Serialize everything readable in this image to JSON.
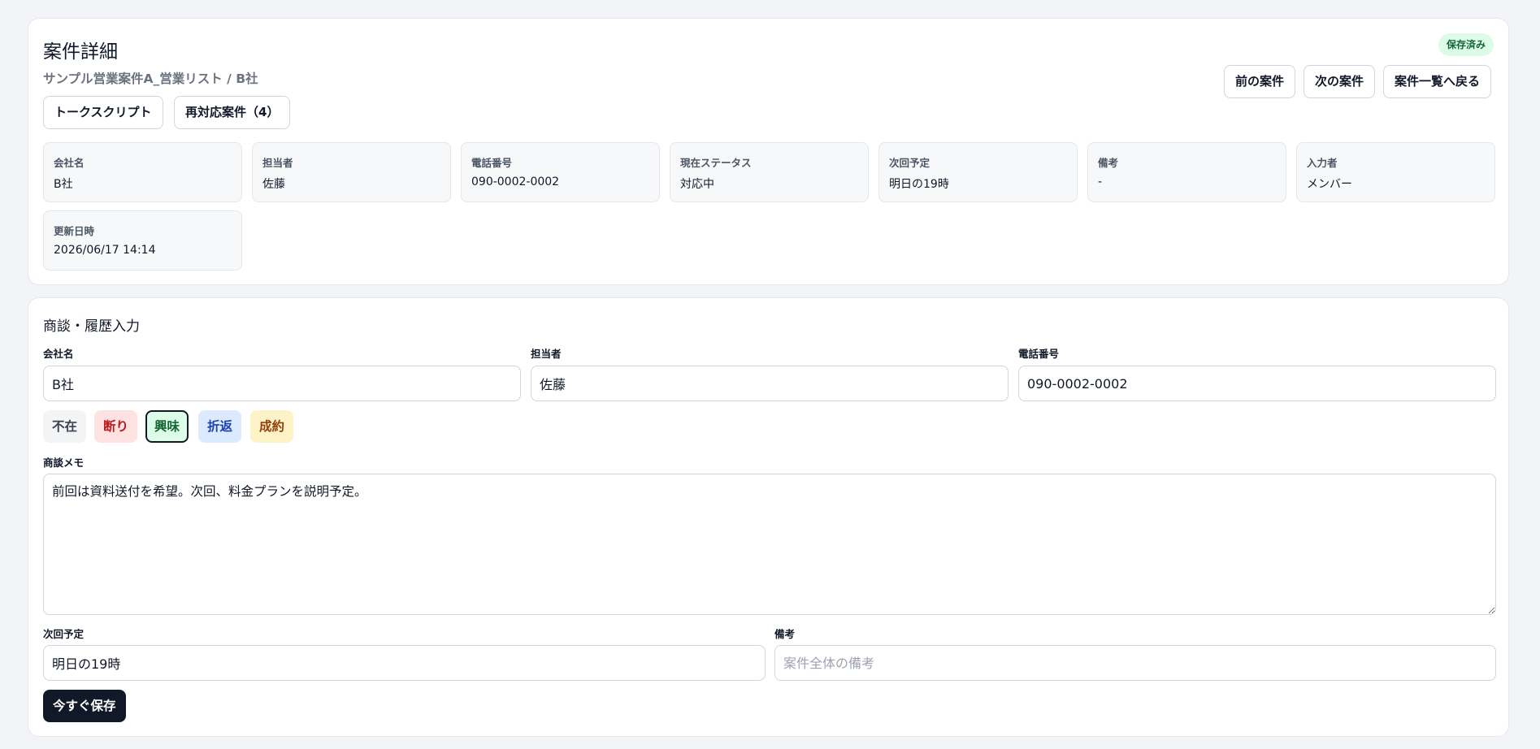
{
  "detail": {
    "title": "案件詳細",
    "subtitle": "サンプル営業案件A_営業リスト / B社",
    "saved_badge": "保存済み",
    "tabs": {
      "talk_script": "トークスクリプト",
      "recontact": "再対応案件（4）"
    },
    "nav": {
      "prev": "前の案件",
      "next": "次の案件",
      "back": "案件一覧へ戻る"
    },
    "info": [
      {
        "label": "会社名",
        "value": "B社"
      },
      {
        "label": "担当者",
        "value": "佐藤"
      },
      {
        "label": "電話番号",
        "value": "090-0002-0002"
      },
      {
        "label": "現在ステータス",
        "value": "対応中"
      },
      {
        "label": "次回予定",
        "value": "明日の19時"
      },
      {
        "label": "備考",
        "value": "-"
      },
      {
        "label": "入力者",
        "value": "メンバー"
      },
      {
        "label": "更新日時",
        "value": "2026/06/17 14:14"
      }
    ]
  },
  "entry": {
    "section_title": "商談・履歴入力",
    "company": {
      "label": "会社名",
      "value": "B社"
    },
    "person": {
      "label": "担当者",
      "value": "佐藤"
    },
    "phone": {
      "label": "電話番号",
      "value": "090-0002-0002"
    },
    "statuses": [
      {
        "label": "不在",
        "bg": "#f3f4f6",
        "color": "#374151",
        "active": false
      },
      {
        "label": "断り",
        "bg": "#fee2e2",
        "color": "#b91c1c",
        "active": false
      },
      {
        "label": "興味",
        "bg": "#dcfce7",
        "color": "#166534",
        "active": true
      },
      {
        "label": "折返",
        "bg": "#dbeafe",
        "color": "#1e40af",
        "active": false
      },
      {
        "label": "成約",
        "bg": "#fef3c7",
        "color": "#92400e",
        "active": false
      }
    ],
    "memo": {
      "label": "商談メモ",
      "value": "前回は資料送付を希望。次回、料金プランを説明予定。"
    },
    "next_plan": {
      "label": "次回予定",
      "value": "明日の19時"
    },
    "note": {
      "label": "備考",
      "placeholder": "案件全体の備考",
      "value": ""
    },
    "save_button": "今すぐ保存"
  }
}
